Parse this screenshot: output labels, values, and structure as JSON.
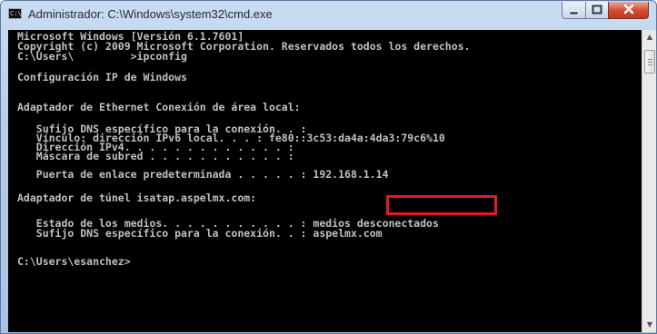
{
  "window": {
    "title": "Administrador: C:\\Windows\\system32\\cmd.exe",
    "icon_label": "C:\\"
  },
  "console": {
    "lines": [
      "Microsoft Windows [Versión 6.1.7601]",
      "Copyright (c) 2009 Microsoft Corporation. Reservados todos los derechos.",
      "",
      "C:\\Users\\         >ipconfig",
      "",
      "Configuración IP de Windows",
      "",
      "",
      "Adaptador de Ethernet Conexión de área local:",
      "",
      "   Sufijo DNS específico para la conexión. . :",
      "   Vínculo: dirección IPv6 local. . . : fe80::3c53:da4a:4da3:79c6%10",
      "   Dirección IPv4. . . . . . . . . . . . . :",
      "   Máscara de subred . . . . . . . . . . . :",
      "   Puerta de enlace predeterminada . . . . . : 192.168.1.14",
      "",
      "Adaptador de túnel isatap.aspelmx.com:",
      "",
      "   Estado de los medios. . . . . . . . . . . : medios desconectados",
      "   Sufijo DNS específico para la conexión. . : aspelmx.com",
      "",
      "C:\\Users\\esanchez>"
    ]
  },
  "colors": {
    "console_bg": "#000000",
    "console_text": "#c0c0c0",
    "highlight": "#e01b24"
  }
}
